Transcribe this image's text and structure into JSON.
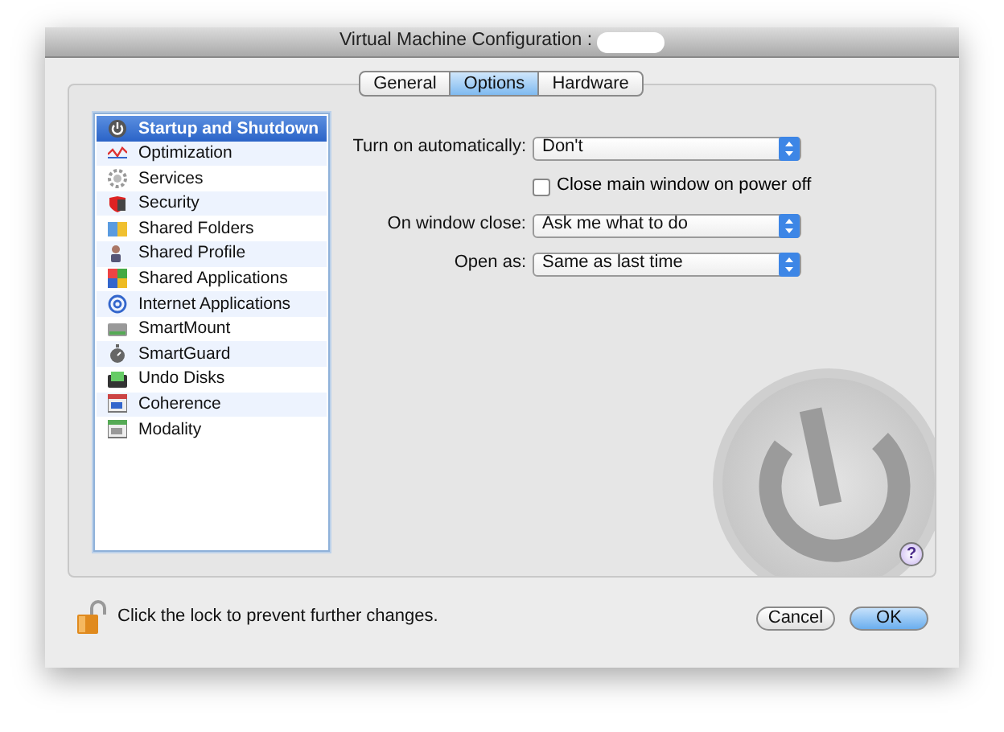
{
  "window": {
    "title": "Virtual Machine Configuration :"
  },
  "tabs": [
    {
      "label": "General",
      "selected": false
    },
    {
      "label": "Options",
      "selected": true
    },
    {
      "label": "Hardware",
      "selected": false
    }
  ],
  "sidebar": {
    "items": [
      {
        "label": "Startup and Shutdown",
        "selected": true
      },
      {
        "label": "Optimization",
        "selected": false
      },
      {
        "label": "Services",
        "selected": false
      },
      {
        "label": "Security",
        "selected": false
      },
      {
        "label": "Shared Folders",
        "selected": false
      },
      {
        "label": "Shared Profile",
        "selected": false
      },
      {
        "label": "Shared Applications",
        "selected": false
      },
      {
        "label": "Internet Applications",
        "selected": false
      },
      {
        "label": "SmartMount",
        "selected": false
      },
      {
        "label": "SmartGuard",
        "selected": false
      },
      {
        "label": "Undo Disks",
        "selected": false
      },
      {
        "label": "Coherence",
        "selected": false
      },
      {
        "label": "Modality",
        "selected": false
      }
    ]
  },
  "options": [
    {
      "kind": "select",
      "label": "Turn on automatically:",
      "value": "Don't"
    },
    {
      "kind": "checkbox",
      "label": "Close main window on power off",
      "checked": false
    },
    {
      "kind": "select",
      "label": "On window close:",
      "value": "Ask me what to do"
    },
    {
      "kind": "select",
      "label": "Open as:",
      "value": "Same as last time"
    }
  ],
  "help": "?",
  "lock_message": "Click the lock to prevent further changes.",
  "buttons": [
    {
      "label": "Cancel",
      "default": false
    },
    {
      "label": "OK",
      "default": true
    }
  ]
}
